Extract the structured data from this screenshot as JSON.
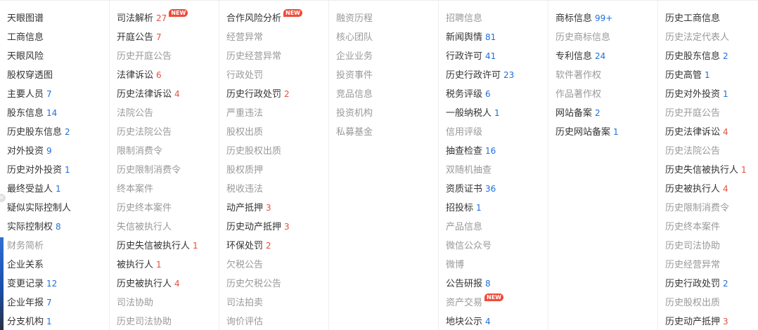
{
  "columns": [
    {
      "items": [
        {
          "label": "天眼图谱",
          "count": "",
          "dim": false
        },
        {
          "label": "工商信息",
          "count": "",
          "dim": false
        },
        {
          "label": "天眼风险",
          "count": "",
          "dim": false
        },
        {
          "label": "股权穿透图",
          "count": "",
          "dim": false
        },
        {
          "label": "主要人员",
          "count": "7",
          "dim": false
        },
        {
          "label": "股东信息",
          "count": "14",
          "dim": false
        },
        {
          "label": "历史股东信息",
          "count": "2",
          "dim": false
        },
        {
          "label": "对外投资",
          "count": "9",
          "dim": false
        },
        {
          "label": "历史对外投资",
          "count": "1",
          "dim": false
        },
        {
          "label": "最终受益人",
          "count": "1",
          "dim": false
        },
        {
          "label": "疑似实际控制人",
          "count": "",
          "dim": false
        },
        {
          "label": "实际控制权",
          "count": "8",
          "dim": false
        },
        {
          "label": "财务简析",
          "count": "",
          "dim": true
        },
        {
          "label": "企业关系",
          "count": "",
          "dim": false
        },
        {
          "label": "变更记录",
          "count": "12",
          "dim": false
        },
        {
          "label": "企业年报",
          "count": "7",
          "dim": false
        },
        {
          "label": "分支机构",
          "count": "1",
          "dim": false
        }
      ]
    },
    {
      "items": [
        {
          "label": "司法解析",
          "count": "27",
          "count_color": "red",
          "badge": "NEW",
          "dim": false
        },
        {
          "label": "开庭公告",
          "count": "7",
          "count_color": "red",
          "dim": false
        },
        {
          "label": "历史开庭公告",
          "count": "",
          "dim": true
        },
        {
          "label": "法律诉讼",
          "count": "6",
          "count_color": "red",
          "dim": false
        },
        {
          "label": "历史法律诉讼",
          "count": "4",
          "count_color": "red",
          "dim": false
        },
        {
          "label": "法院公告",
          "count": "",
          "dim": true
        },
        {
          "label": "历史法院公告",
          "count": "",
          "dim": true
        },
        {
          "label": "限制消费令",
          "count": "",
          "dim": true
        },
        {
          "label": "历史限制消费令",
          "count": "",
          "dim": true
        },
        {
          "label": "终本案件",
          "count": "",
          "dim": true
        },
        {
          "label": "历史终本案件",
          "count": "",
          "dim": true
        },
        {
          "label": "失信被执行人",
          "count": "",
          "dim": true
        },
        {
          "label": "历史失信被执行人",
          "count": "1",
          "count_color": "red",
          "dim": false
        },
        {
          "label": "被执行人",
          "count": "1",
          "count_color": "red",
          "dim": false
        },
        {
          "label": "历史被执行人",
          "count": "4",
          "count_color": "red",
          "dim": false
        },
        {
          "label": "司法协助",
          "count": "",
          "dim": true
        },
        {
          "label": "历史司法协助",
          "count": "",
          "dim": true
        }
      ]
    },
    {
      "items": [
        {
          "label": "合作风险分析",
          "count": "",
          "badge": "NEW",
          "dim": false
        },
        {
          "label": "经营异常",
          "count": "",
          "dim": true
        },
        {
          "label": "历史经营异常",
          "count": "",
          "dim": true
        },
        {
          "label": "行政处罚",
          "count": "",
          "dim": true
        },
        {
          "label": "历史行政处罚",
          "count": "2",
          "count_color": "red",
          "dim": false
        },
        {
          "label": "严重违法",
          "count": "",
          "dim": true
        },
        {
          "label": "股权出质",
          "count": "",
          "dim": true
        },
        {
          "label": "历史股权出质",
          "count": "",
          "dim": true
        },
        {
          "label": "股权质押",
          "count": "",
          "dim": true
        },
        {
          "label": "税收违法",
          "count": "",
          "dim": true
        },
        {
          "label": "动产抵押",
          "count": "3",
          "count_color": "red",
          "dim": false
        },
        {
          "label": "历史动产抵押",
          "count": "3",
          "count_color": "red",
          "dim": false
        },
        {
          "label": "环保处罚",
          "count": "2",
          "count_color": "red",
          "dim": false
        },
        {
          "label": "欠税公告",
          "count": "",
          "dim": true
        },
        {
          "label": "历史欠税公告",
          "count": "",
          "dim": true
        },
        {
          "label": "司法拍卖",
          "count": "",
          "dim": true
        },
        {
          "label": "询价评估",
          "count": "",
          "dim": true
        }
      ]
    },
    {
      "items": [
        {
          "label": "融资历程",
          "count": "",
          "dim": true
        },
        {
          "label": "核心团队",
          "count": "",
          "dim": true
        },
        {
          "label": "企业业务",
          "count": "",
          "dim": true
        },
        {
          "label": "投资事件",
          "count": "",
          "dim": true
        },
        {
          "label": "竞品信息",
          "count": "",
          "dim": true
        },
        {
          "label": "投资机构",
          "count": "",
          "dim": true
        },
        {
          "label": "私募基金",
          "count": "",
          "dim": true
        }
      ]
    },
    {
      "items": [
        {
          "label": "招聘信息",
          "count": "",
          "dim": true
        },
        {
          "label": "新闻舆情",
          "count": "81",
          "dim": false
        },
        {
          "label": "行政许可",
          "count": "41",
          "dim": false
        },
        {
          "label": "历史行政许可",
          "count": "23",
          "dim": false
        },
        {
          "label": "税务评级",
          "count": "6",
          "dim": false
        },
        {
          "label": "一般纳税人",
          "count": "1",
          "dim": false
        },
        {
          "label": "信用评级",
          "count": "",
          "dim": true
        },
        {
          "label": "抽查检查",
          "count": "16",
          "dim": false
        },
        {
          "label": "双随机抽查",
          "count": "",
          "dim": true
        },
        {
          "label": "资质证书",
          "count": "36",
          "dim": false
        },
        {
          "label": "招投标",
          "count": "1",
          "dim": false
        },
        {
          "label": "产品信息",
          "count": "",
          "dim": true
        },
        {
          "label": "微信公众号",
          "count": "",
          "dim": true
        },
        {
          "label": "微博",
          "count": "",
          "dim": true
        },
        {
          "label": "公告研报",
          "count": "8",
          "dim": false
        },
        {
          "label": "资产交易",
          "count": "",
          "badge": "NEW",
          "dim": true
        },
        {
          "label": "地块公示",
          "count": "4",
          "dim": false
        }
      ]
    },
    {
      "items": [
        {
          "label": "商标信息",
          "count": "99+",
          "dim": false
        },
        {
          "label": "历史商标信息",
          "count": "",
          "dim": true
        },
        {
          "label": "专利信息",
          "count": "24",
          "dim": false
        },
        {
          "label": "软件著作权",
          "count": "",
          "dim": true
        },
        {
          "label": "作品著作权",
          "count": "",
          "dim": true
        },
        {
          "label": "网站备案",
          "count": "2",
          "dim": false
        },
        {
          "label": "历史网站备案",
          "count": "1",
          "dim": false
        }
      ]
    },
    {
      "items": [
        {
          "label": "历史工商信息",
          "count": "",
          "dim": false
        },
        {
          "label": "历史法定代表人",
          "count": "",
          "dim": true
        },
        {
          "label": "历史股东信息",
          "count": "2",
          "dim": false
        },
        {
          "label": "历史高管",
          "count": "1",
          "dim": false
        },
        {
          "label": "历史对外投资",
          "count": "1",
          "dim": false
        },
        {
          "label": "历史开庭公告",
          "count": "",
          "dim": true
        },
        {
          "label": "历史法律诉讼",
          "count": "4",
          "count_color": "red",
          "dim": false
        },
        {
          "label": "历史法院公告",
          "count": "",
          "dim": true
        },
        {
          "label": "历史失信被执行人",
          "count": "1",
          "count_color": "red",
          "dim": false
        },
        {
          "label": "历史被执行人",
          "count": "4",
          "count_color": "red",
          "dim": false
        },
        {
          "label": "历史限制消费令",
          "count": "",
          "dim": true
        },
        {
          "label": "历史终本案件",
          "count": "",
          "dim": true
        },
        {
          "label": "历史司法协助",
          "count": "",
          "dim": true
        },
        {
          "label": "历史经营异常",
          "count": "",
          "dim": true
        },
        {
          "label": "历史行政处罚",
          "count": "2",
          "dim": false
        },
        {
          "label": "历史股权出质",
          "count": "",
          "dim": true
        },
        {
          "label": "历史动产抵押",
          "count": "3",
          "count_color": "red",
          "dim": false
        }
      ]
    }
  ],
  "colors": {
    "count_blue": "#1e6fd9",
    "count_red": "#e6503d",
    "badge_bg": "#f04b3a",
    "text_active": "#333333",
    "text_dim": "#999999"
  }
}
